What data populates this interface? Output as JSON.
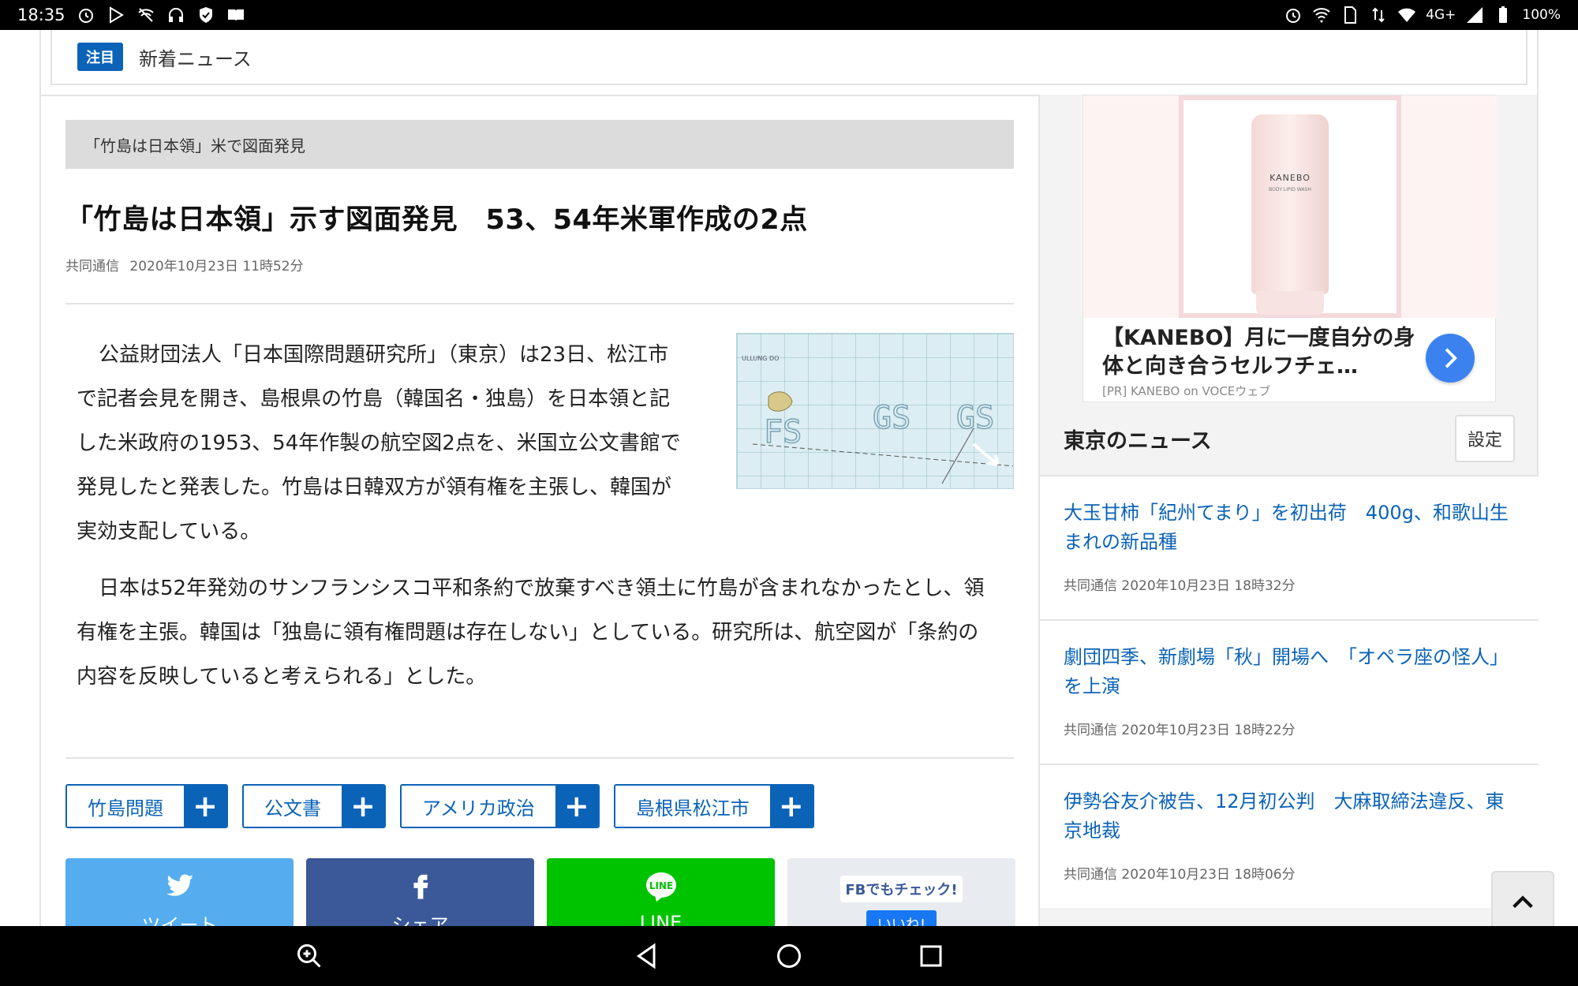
{
  "status_bar": {
    "time": "18:35",
    "network": "4G+",
    "battery": "100%"
  },
  "ticker": {
    "badge": "注目",
    "text": "新着ニュース"
  },
  "article": {
    "breadcrumb": "「竹島は日本領」米で図面発見",
    "headline": "「竹島は日本領」示す図面発見　53、54年米軍作成の2点",
    "source": "共同通信",
    "datetime": "2020年10月23日 11時52分",
    "paragraphs": [
      "公益財団法人「日本国際問題研究所」（東京）は23日、松江市で記者会見を開き、島根県の竹島（韓国名・独島）を日本領と記した米政府の1953、54年作製の航空図2点を、米国立公文書館で発見したと発表した。竹島は日韓双方が領有権を主張し、韓国が実効支配している。",
      "日本は52年発効のサンフランシスコ平和条約で放棄すべき領土に竹島が含まれなかったとし、領有権を主張。韓国は「独島に領有権問題は存在しない」としている。研究所は、航空図が「条約の内容を反映していると考えられる」とした。"
    ],
    "figure_labels": {
      "fs": "FS",
      "gs1": "GS",
      "gs2": "GS",
      "island": "ULLUNG DO"
    }
  },
  "tags": [
    {
      "label": "竹島問題"
    },
    {
      "label": "公文書"
    },
    {
      "label": "アメリカ政治"
    },
    {
      "label": "島根県松江市"
    }
  ],
  "share": {
    "twitter": "ツイート",
    "facebook": "シェア",
    "line": "LINE",
    "fb_check": "FBでもチェック!",
    "like": "いいね!"
  },
  "ad": {
    "title": "【KANEBO】月に一度自分の身体と向き合うセルフチェ…",
    "source": "[PR] KANEBO on VOCEウェブ",
    "product_brand": "KANEBO",
    "product_sub": "BODY LIPID WASH"
  },
  "sidebar": {
    "title": "東京のニュース",
    "settings_label": "設定",
    "news": [
      {
        "title": "大玉甘柿「紀州てまり」を初出荷　400g、和歌山生まれの新品種",
        "source": "共同通信",
        "datetime": "2020年10月23日 18時32分"
      },
      {
        "title": "劇団四季、新劇場「秋」開場へ　「オペラ座の怪人」を上演",
        "source": "共同通信",
        "datetime": "2020年10月23日 18時22分"
      },
      {
        "title": "伊勢谷友介被告、12月初公判　大麻取締法違反、東京地裁",
        "source": "共同通信",
        "datetime": "2020年10月23日 18時06分"
      }
    ]
  },
  "colors": {
    "accent": "#0b63b8",
    "twitter": "#55acee",
    "facebook": "#3b5998",
    "line": "#00c300"
  }
}
